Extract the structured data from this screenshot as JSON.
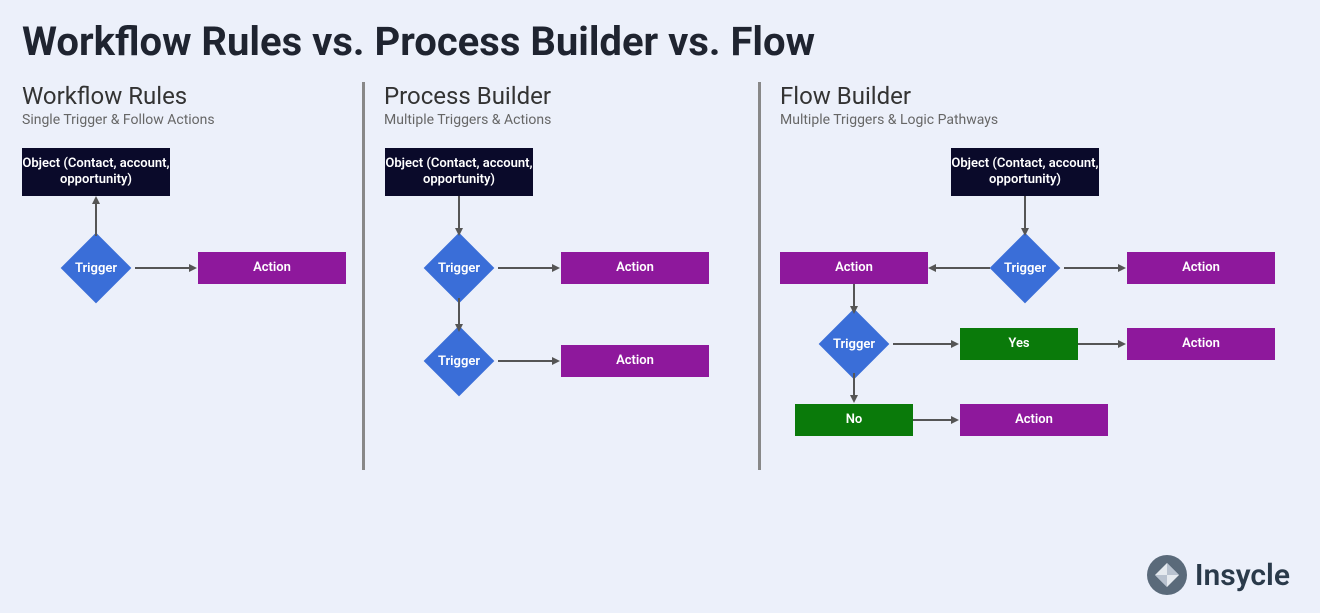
{
  "title": "Workflow Rules vs. Process Builder vs. Flow",
  "sections": {
    "workflow": {
      "title": "Workflow Rules",
      "subtitle": "Single Trigger & Follow Actions"
    },
    "process": {
      "title": "Process Builder",
      "subtitle": "Multiple Triggers & Actions"
    },
    "flow": {
      "title": "Flow Builder",
      "subtitle": "Multiple Triggers & Logic Pathways"
    }
  },
  "labels": {
    "object": "Object (Contact, account, opportunity)",
    "trigger": "Trigger",
    "action": "Action",
    "yes": "Yes",
    "no": "No"
  },
  "logo": "Insycle",
  "colors": {
    "object": "#0a0a2a",
    "trigger": "#3a6ed8",
    "action": "#8e189c",
    "decision": "#0a7a0a"
  }
}
